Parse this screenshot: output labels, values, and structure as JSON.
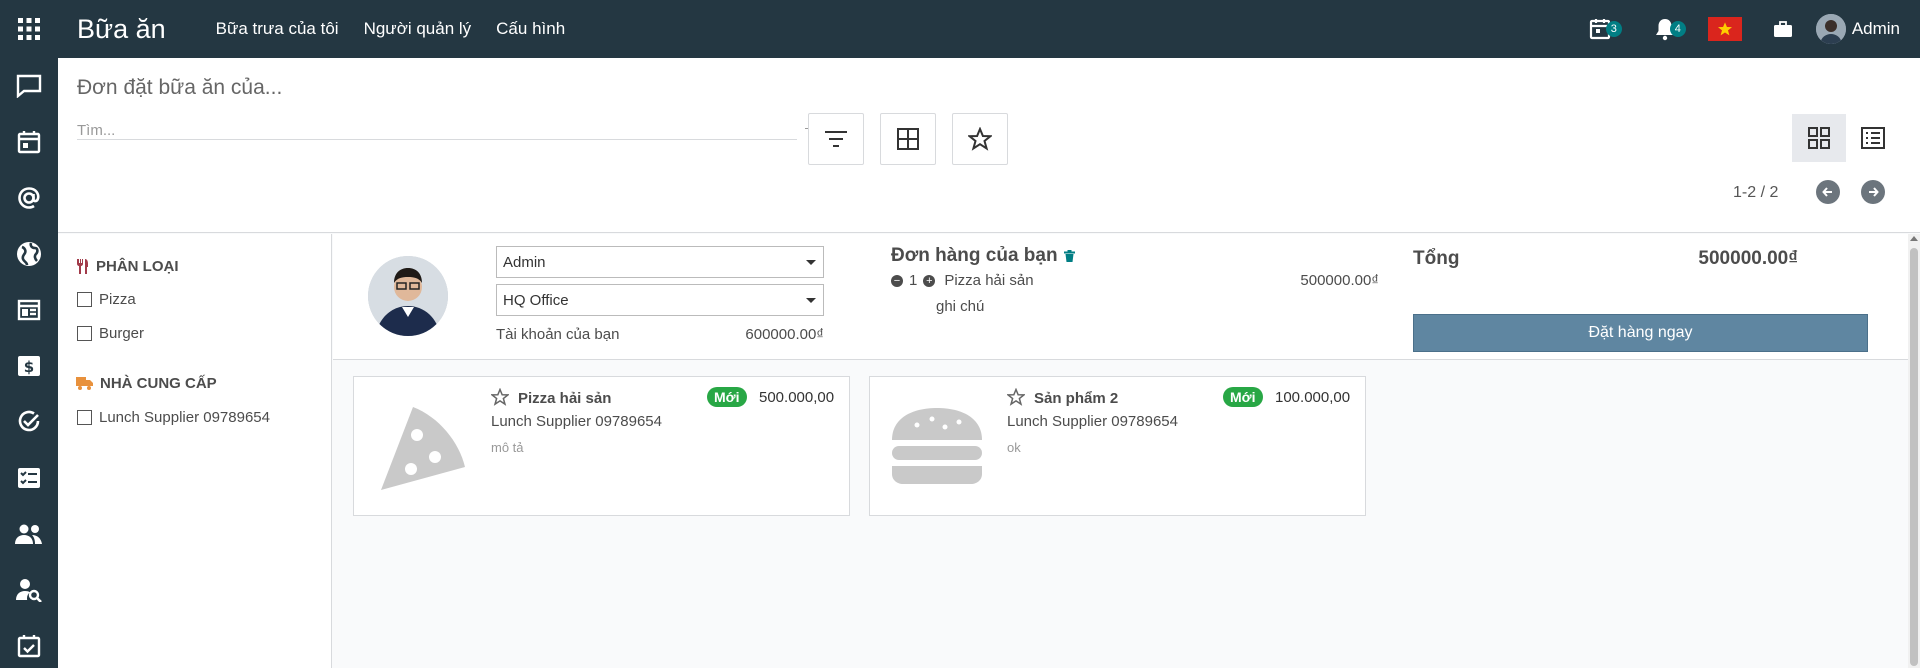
{
  "app": {
    "title": "Bữa ăn",
    "menu": [
      "Bữa trưa của tôi",
      "Người quản lý",
      "Cấu hình"
    ]
  },
  "systray": {
    "activity_count": "3",
    "notification_count": "4",
    "user_name": "Admin"
  },
  "sidebar_icons": [
    "chat-icon",
    "calendar-icon",
    "at-sign-icon",
    "globe-icon",
    "news-icon",
    "money-icon",
    "check-circle-icon",
    "task-list-icon",
    "contacts-icon",
    "user-search-icon",
    "calendar-check-icon"
  ],
  "control_panel": {
    "breadcrumb": "Đơn đặt bữa ăn của...",
    "search_placeholder": "Tìm...",
    "pager": "1-2 / 2"
  },
  "search_panel": {
    "category_title": "PHÂN LOẠI",
    "categories": [
      "Pizza",
      "Burger"
    ],
    "supplier_title": "NHÀ CUNG CẤP",
    "suppliers": [
      "Lunch Supplier 09789654"
    ]
  },
  "order": {
    "user_select": "Admin",
    "location_select": "HQ Office",
    "account_label": "Tài khoản của bạn",
    "account_value": "600000.00₫",
    "your_order_title": "Đơn hàng của bạn",
    "line": {
      "quantity": "1",
      "product": "Pizza hải sản",
      "price": "500000.00₫",
      "note": "ghi chú"
    },
    "total_label": "Tổng",
    "total_value": "500000.00₫",
    "order_button": "Đặt hàng ngay"
  },
  "products": [
    {
      "name": "Pizza hải sản",
      "badge": "Mới",
      "price": "500.000,00",
      "supplier": "Lunch Supplier 09789654",
      "description": "mô tả",
      "icon": "pizza-icon"
    },
    {
      "name": "Sản phẩm 2",
      "badge": "Mới",
      "price": "100.000,00",
      "supplier": "Lunch Supplier 09789654",
      "description": "ok",
      "icon": "burger-icon"
    }
  ],
  "colors": {
    "navbar": "#243742",
    "order_button": "#5f86a1",
    "new_badge": "#28a745",
    "badge_count": "#017e84"
  }
}
